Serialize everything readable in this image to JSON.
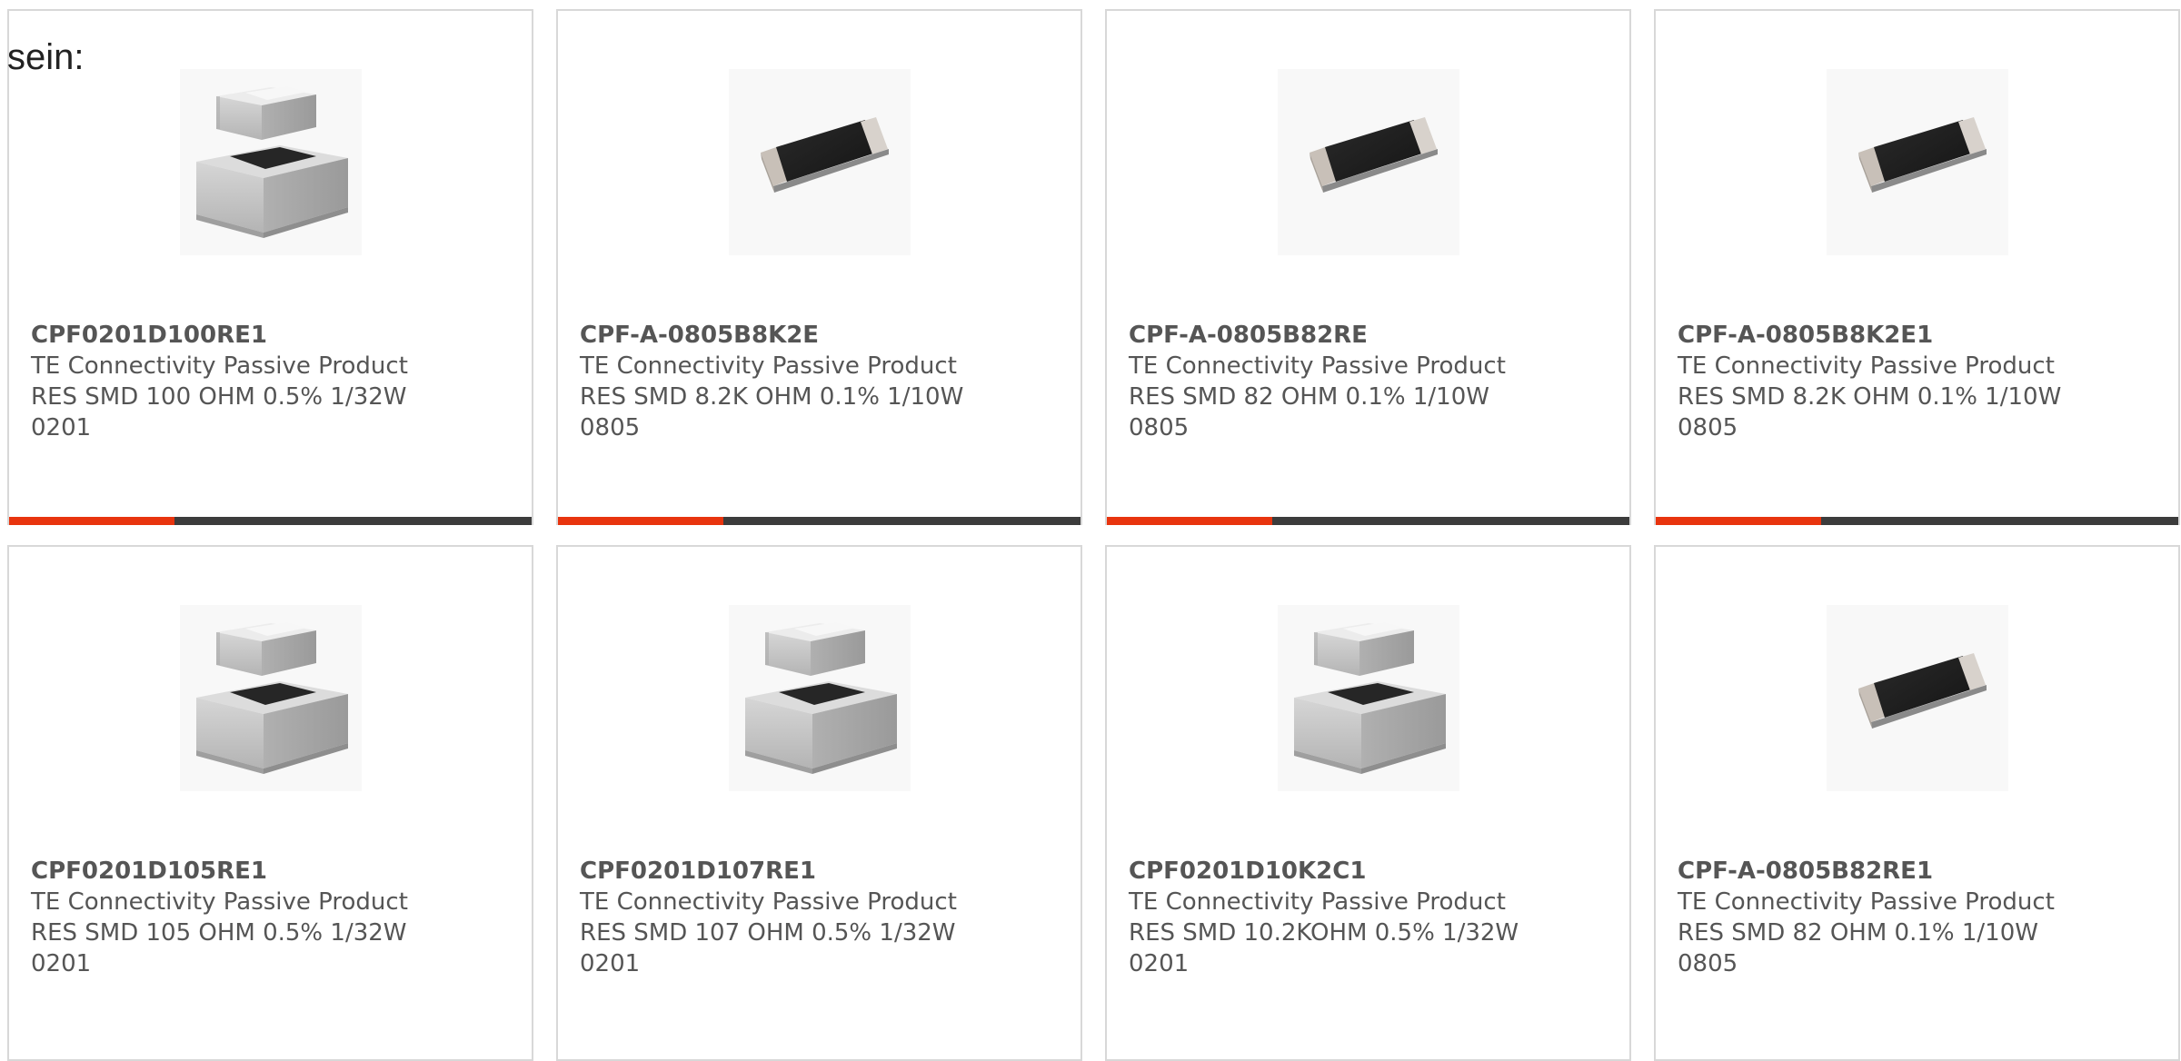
{
  "intro_text": "sein:",
  "colors": {
    "accent": "#e8340e",
    "bar": "#3c3c3c",
    "card_border": "#d8d8d8",
    "text": "#555555"
  },
  "products": [
    {
      "part_number": "CPF0201D100RE1",
      "manufacturer": "TE Connectivity Passive Product",
      "description": "RES SMD 100 OHM 0.5% 1/32W",
      "package": "0201",
      "image_icon": "stacked-chip-resistor-icon"
    },
    {
      "part_number": "CPF-A-0805B8K2E",
      "manufacturer": "TE Connectivity Passive Product",
      "description": "RES SMD 8.2K OHM 0.1% 1/10W",
      "package": "0805",
      "image_icon": "flat-chip-resistor-icon"
    },
    {
      "part_number": "CPF-A-0805B82RE",
      "manufacturer": "TE Connectivity Passive Product",
      "description": "RES SMD 82 OHM 0.1% 1/10W",
      "package": "0805",
      "image_icon": "flat-chip-resistor-icon"
    },
    {
      "part_number": "CPF-A-0805B8K2E1",
      "manufacturer": "TE Connectivity Passive Product",
      "description": "RES SMD 8.2K OHM 0.1% 1/10W",
      "package": "0805",
      "image_icon": "flat-chip-resistor-icon"
    },
    {
      "part_number": "CPF0201D105RE1",
      "manufacturer": "TE Connectivity Passive Product",
      "description": "RES SMD 105 OHM 0.5% 1/32W",
      "package": "0201",
      "image_icon": "stacked-chip-resistor-icon"
    },
    {
      "part_number": "CPF0201D107RE1",
      "manufacturer": "TE Connectivity Passive Product",
      "description": "RES SMD 107 OHM 0.5% 1/32W",
      "package": "0201",
      "image_icon": "stacked-chip-resistor-icon"
    },
    {
      "part_number": "CPF0201D10K2C1",
      "manufacturer": "TE Connectivity Passive Product",
      "description": "RES SMD 10.2KOHM 0.5% 1/32W",
      "package": "0201",
      "image_icon": "stacked-chip-resistor-icon"
    },
    {
      "part_number": "CPF-A-0805B82RE1",
      "manufacturer": "TE Connectivity Passive Product",
      "description": "RES SMD 82 OHM 0.1% 1/10W",
      "package": "0805",
      "image_icon": "flat-chip-resistor-icon"
    }
  ]
}
